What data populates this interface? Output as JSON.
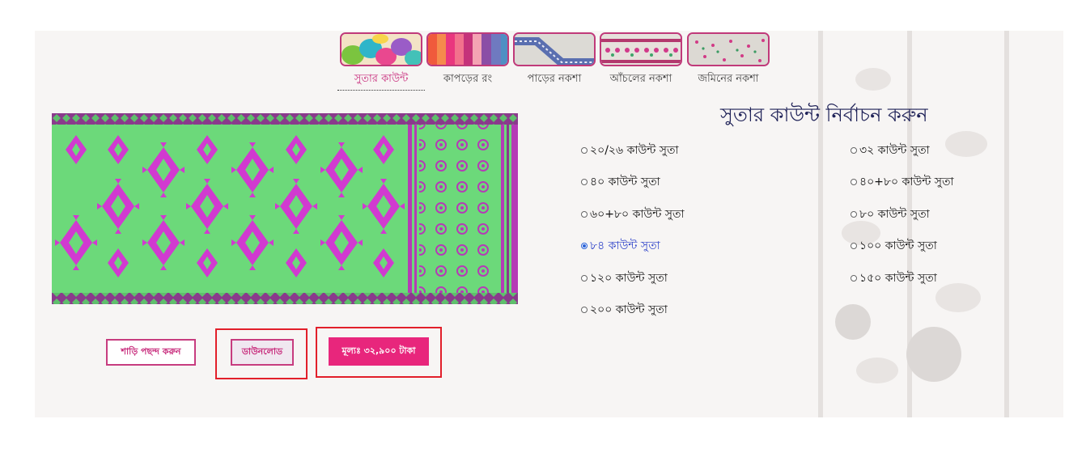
{
  "tabs": [
    {
      "label": "সুতার কাউন্ট",
      "active": true
    },
    {
      "label": "কাপড়ের রং",
      "active": false
    },
    {
      "label": "পাড়ের নকশা",
      "active": false
    },
    {
      "label": "আঁচলের নকশা",
      "active": false
    },
    {
      "label": "জমিনের নকশা",
      "active": false
    }
  ],
  "main": {
    "title": "সুতার কাউন্ট নির্বাচন করুন"
  },
  "options": [
    {
      "label": "২০/২৬ কাউন্ট সুতা",
      "checked": false
    },
    {
      "label": "৩২ কাউন্ট সুতা",
      "checked": false
    },
    {
      "label": "৪০ কাউন্ট সুতা",
      "checked": false
    },
    {
      "label": "৪০+৮০ কাউন্ট সুতা",
      "checked": false
    },
    {
      "label": "৬০+৮০ কাউন্ট সুতা",
      "checked": false
    },
    {
      "label": "৮০ কাউন্ট সুতা",
      "checked": false
    },
    {
      "label": "৮৪ কাউন্ট সুতা",
      "checked": true
    },
    {
      "label": "১০০ কাউন্ট সুতা",
      "checked": false
    },
    {
      "label": "১২০ কাউন্ট সুতা",
      "checked": false
    },
    {
      "label": "১৫০ কাউন্ট সুতা",
      "checked": false
    },
    {
      "label": "২০০ কাউন্ট সুতা",
      "checked": false
    }
  ],
  "buttons": {
    "choose": "শাড়ি পছন্দ করুন",
    "download": "ডাউনলোড",
    "price": "মূল্যঃ ৩২,৯০০ টাকা"
  },
  "colors": {
    "accent": "#e8267c",
    "saree_body": "#6cd97a",
    "saree_motif": "#d13ad0",
    "title": "#1f2258",
    "highlight": "#e21f2a"
  }
}
